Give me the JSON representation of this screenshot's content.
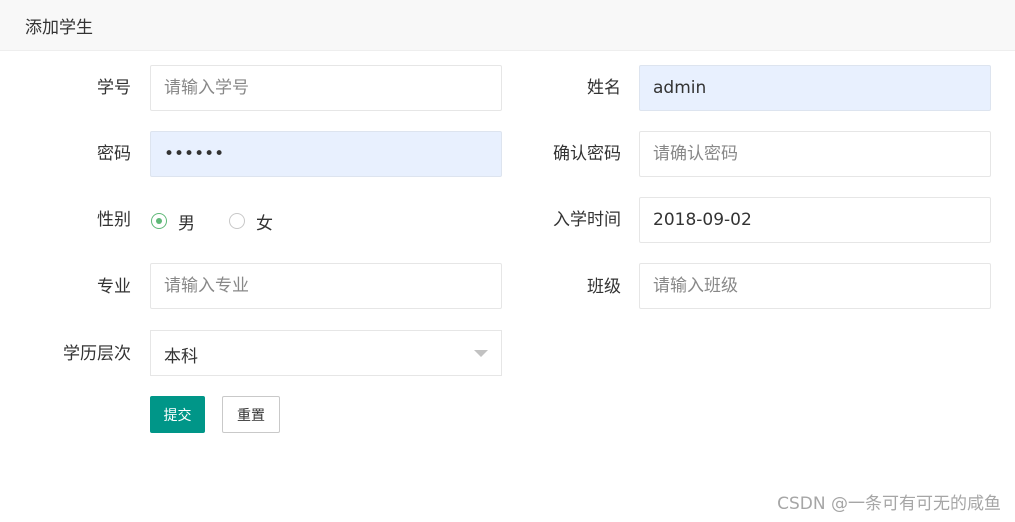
{
  "panel": {
    "title": "添加学生"
  },
  "form": {
    "student_id": {
      "label": "学号",
      "placeholder": "请输入学号",
      "value": ""
    },
    "name": {
      "label": "姓名",
      "placeholder": "",
      "value": "admin"
    },
    "password": {
      "label": "密码",
      "value": "••••••"
    },
    "confirm_password": {
      "label": "确认密码",
      "placeholder": "请确认密码",
      "value": ""
    },
    "gender": {
      "label": "性别",
      "options": [
        {
          "label": "男",
          "checked": true
        },
        {
          "label": "女",
          "checked": false
        }
      ]
    },
    "enroll_date": {
      "label": "入学时间",
      "value": "2018-09-02"
    },
    "major": {
      "label": "专业",
      "placeholder": "请输入专业",
      "value": ""
    },
    "class": {
      "label": "班级",
      "placeholder": "请输入班级",
      "value": ""
    },
    "education_level": {
      "label": "学历层次",
      "selected": "本科"
    }
  },
  "buttons": {
    "submit": "提交",
    "reset": "重置"
  },
  "watermark": "CSDN @一条可有可无的咸鱼",
  "colors": {
    "primary": "#009688",
    "radio_checked": "#5fb878",
    "autofill_bg": "#e8f0fe"
  }
}
